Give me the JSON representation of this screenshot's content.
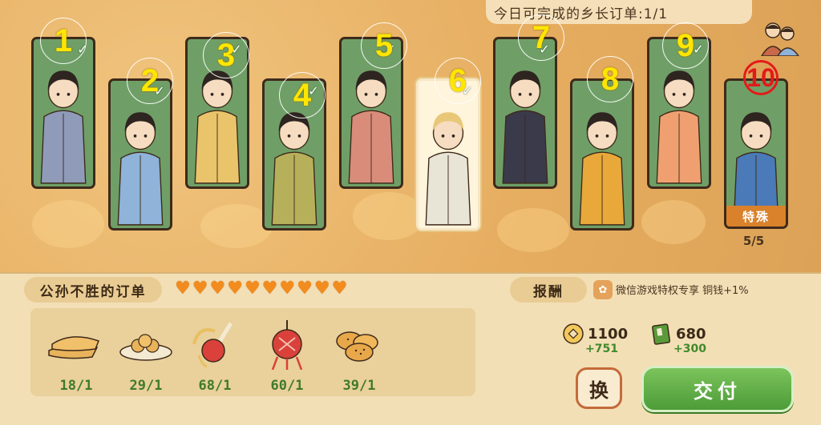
{
  "header": {
    "orders_banner": "今日可完成的乡长订单:1/1"
  },
  "cards": [
    {
      "number": "1",
      "checked": true,
      "robe": "#8f9bb8",
      "selected": false
    },
    {
      "number": "2",
      "checked": true,
      "robe": "#8fb3d9",
      "selected": false
    },
    {
      "number": "3",
      "checked": true,
      "robe": "#e9c46a",
      "selected": false
    },
    {
      "number": "4",
      "checked": true,
      "robe": "#b7b05a",
      "selected": false
    },
    {
      "number": "5",
      "checked": true,
      "robe": "#d98c7a",
      "selected": false
    },
    {
      "number": "6",
      "checked": true,
      "robe": "#e8e4d6",
      "selected": true
    },
    {
      "number": "7",
      "checked": true,
      "robe": "#3a3a4a",
      "selected": false
    },
    {
      "number": "8",
      "checked": false,
      "robe": "#e8a83a",
      "selected": false
    },
    {
      "number": "9",
      "checked": true,
      "robe": "#f0a070",
      "selected": false
    },
    {
      "number": "⑩",
      "checked": false,
      "robe": "#4a7ab8",
      "selected": false
    }
  ],
  "special": {
    "tag": "特殊",
    "count": "5/5"
  },
  "order": {
    "customer_label": "公孙不胜的订单",
    "hearts": 10,
    "items": [
      {
        "icon": "flatbread-icon",
        "qty": "18/1"
      },
      {
        "icon": "dumplings-plate-icon",
        "qty": "29/1"
      },
      {
        "icon": "red-pouch-icon",
        "qty": "68/1"
      },
      {
        "icon": "knot-ornament-icon",
        "qty": "60/1"
      },
      {
        "icon": "sesame-cakes-icon",
        "qty": "39/1"
      }
    ]
  },
  "reward": {
    "label": "报酬",
    "wechat_text": "微信游戏特权专享  铜钱+1%",
    "coins": "1100",
    "coins_bonus": "+751",
    "books": "680",
    "books_bonus": "+300"
  },
  "buttons": {
    "swap": "换",
    "deliver": "交付"
  }
}
